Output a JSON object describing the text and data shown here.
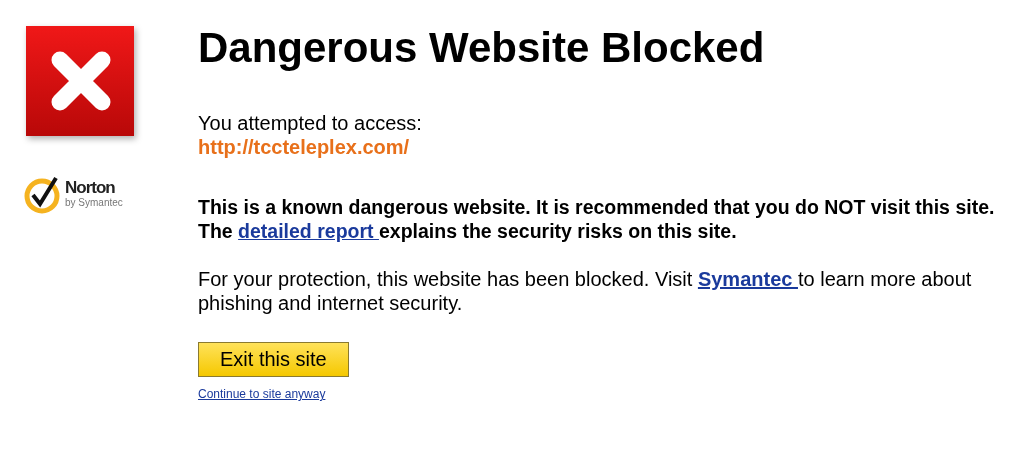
{
  "brand": {
    "name": "Norton",
    "byline": "by Symantec"
  },
  "title": "Dangerous Website Blocked",
  "attempt": {
    "label": "You attempted to access:",
    "url": "http://tccteleplex.com/"
  },
  "warning": {
    "before": "This is a known dangerous website. It is recommended that you do NOT visit this site. The ",
    "link": "detailed report ",
    "after": "explains the security risks on this site."
  },
  "protection": {
    "before": "For your protection, this website has been blocked. Visit ",
    "link": "Symantec ",
    "after": "to learn more about phishing and internet security."
  },
  "exit_button": "Exit this site",
  "continue_link": "Continue to site anyway"
}
